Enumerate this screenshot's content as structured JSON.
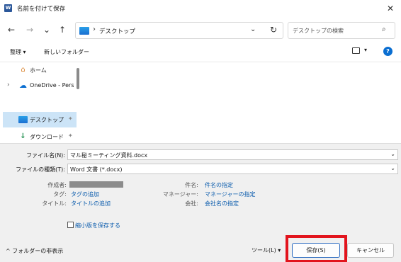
{
  "title": {
    "app_icon_letter": "W",
    "text": "名前を付けて保存",
    "close": "✕"
  },
  "nav": {
    "back": "←",
    "forward": "→",
    "recent": "⌄",
    "up": "↑",
    "separator": "›",
    "address": "デスクトップ",
    "address_dropdown": "⌄",
    "refresh": "↻",
    "search_placeholder": "デスクトップの検索",
    "search_icon": "⌕"
  },
  "toolbar": {
    "organize": "整理 ▾",
    "new_folder": "新しいフォルダー",
    "view_dropdown": "▾",
    "help": "?"
  },
  "navpane": {
    "items": [
      {
        "label": "ホーム",
        "icon": "home-icon",
        "glyph": "⌂",
        "expander": "",
        "pinned": false
      },
      {
        "label": "OneDrive - Perso",
        "icon": "cloud-icon",
        "glyph": "☁",
        "expander": "›",
        "pinned": false
      },
      {
        "label": "デスクトップ",
        "icon": "desktop-icon",
        "glyph": "",
        "expander": "",
        "pinned": true
      },
      {
        "label": "ダウンロード",
        "icon": "download-icon",
        "glyph": "↓",
        "expander": "",
        "pinned": true
      }
    ],
    "pin_glyph": "📌"
  },
  "form": {
    "filename_label": "ファイル名(N):",
    "filename_value": "マル秘ミーティング資料.docx",
    "filetype_label": "ファイルの種類(T):",
    "filetype_value": "Word 文書 (*.docx)",
    "dropdown_glyph": "⌄"
  },
  "meta": {
    "author_label": "作成者:",
    "tags_label": "タグ:",
    "tags_value": "タグの追加",
    "title_label": "タイトル:",
    "title_value": "タイトルの追加",
    "subject_label": "件名:",
    "subject_value": "件名の指定",
    "manager_label": "マネージャー:",
    "manager_value": "マネージャーの指定",
    "company_label": "会社:",
    "company_value": "会社名の指定",
    "thumbnail_label": "縮小版を保存する",
    "thumbnail_checked": false
  },
  "footer": {
    "hide_folders": "^ フォルダーの非表示",
    "tools": "ツール(L)  ▾",
    "save": "保存(S)",
    "cancel": "キャンセル"
  },
  "colors": {
    "accent": "#0b5cad",
    "highlight_border": "#e2141d",
    "selected_bg": "#cce4f7"
  }
}
